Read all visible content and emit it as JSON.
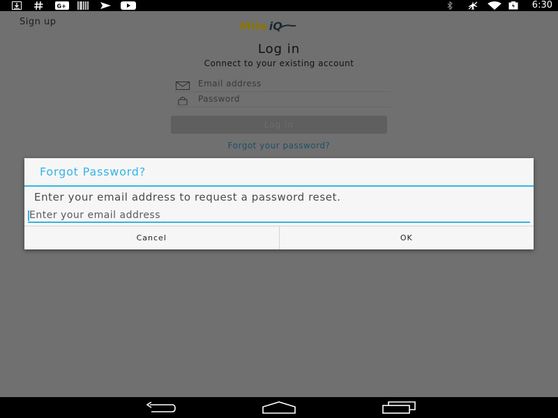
{
  "status_bar": {
    "left_icons": [
      "download-icon",
      "hashtag-icon",
      "google-plus-icon",
      "barcode-icon",
      "flight-icon",
      "youtube-icon"
    ],
    "right_icons": [
      "bluetooth-icon",
      "airplane-mode-icon",
      "wifi-icon",
      "battery-icon"
    ],
    "time": "6:30"
  },
  "app": {
    "signup_label": "Sign up",
    "logo_text_mile": "Mile",
    "logo_text_iq": "iQ",
    "title": "Log in",
    "subtitle": "Connect to your existing account",
    "email_placeholder": "Email address",
    "password_placeholder": "Password",
    "login_button_label": "Log In",
    "forgot_link": "Forgot your password?"
  },
  "dialog": {
    "title": "Forgot Password?",
    "message": "Enter your email address to request a password reset.",
    "email_placeholder": "Enter your email address",
    "email_value": "",
    "cancel_label": "Cancel",
    "ok_label": "OK",
    "accent_color": "#33b5e5"
  },
  "nav_bar": {
    "buttons": [
      "back-icon",
      "home-icon",
      "recents-icon"
    ]
  }
}
